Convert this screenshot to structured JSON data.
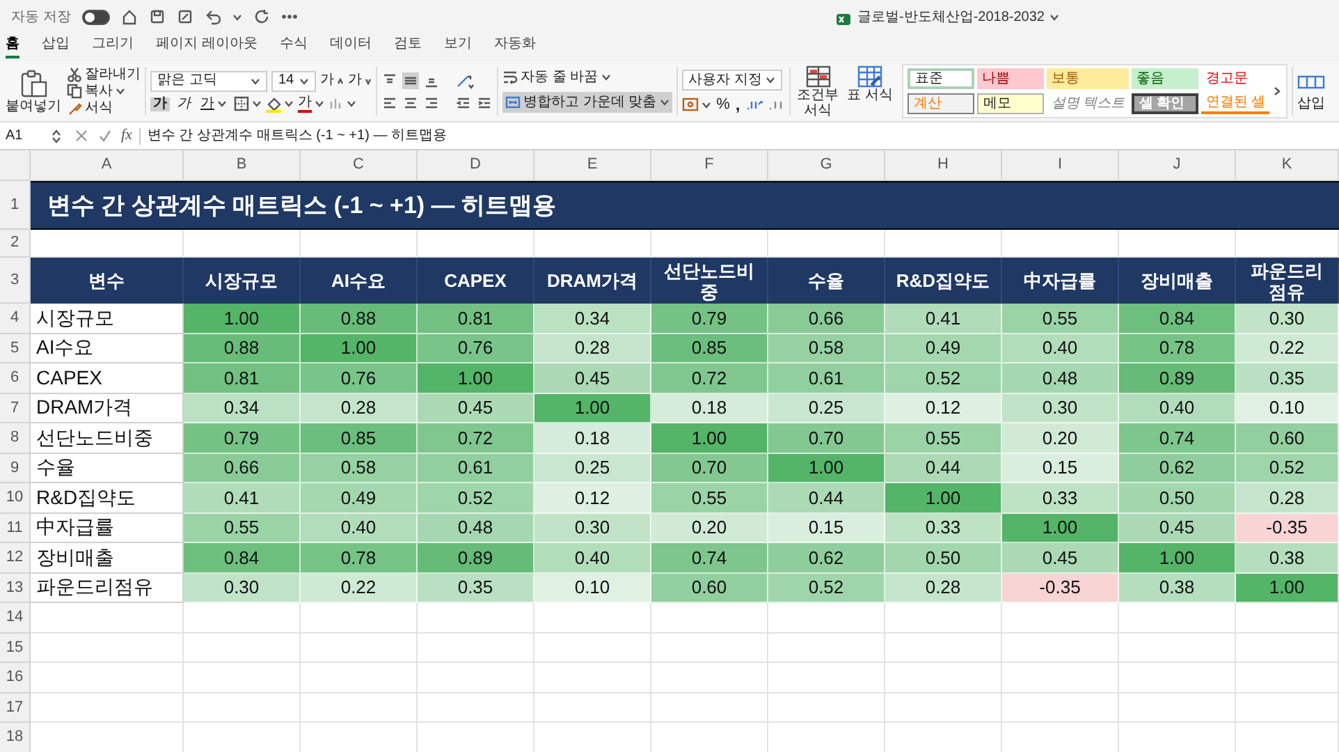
{
  "quick_access": {
    "autosave_label": "자동 저장",
    "autosave_on": false
  },
  "document_title": "글로벌-반도체산업-2018-2032",
  "tabs": [
    {
      "label": "홈",
      "selected": true
    },
    {
      "label": "삽입",
      "selected": false
    },
    {
      "label": "그리기",
      "selected": false
    },
    {
      "label": "페이지 레이아웃",
      "selected": false
    },
    {
      "label": "수식",
      "selected": false
    },
    {
      "label": "데이터",
      "selected": false
    },
    {
      "label": "검토",
      "selected": false
    },
    {
      "label": "보기",
      "selected": false
    },
    {
      "label": "자동화",
      "selected": false
    }
  ],
  "ribbon": {
    "clipboard": {
      "paste": "붙여넣기",
      "cut": "잘라내기",
      "copy": "복사",
      "format_painter": "서식"
    },
    "font": {
      "name": "맑은 고딕",
      "size": "14",
      "grow_glyph": "가",
      "shrink_glyph": "가",
      "bold_glyph": "가",
      "italic_glyph": "가",
      "underline_glyph": "가",
      "color_glyph": "가",
      "bold_on": true
    },
    "wrap_text": "자동 줄 바꿈",
    "merge_center": {
      "label": "병합하고 가운데 맞춤",
      "on": true
    },
    "number_format": "사용자 지정",
    "percent": "%",
    "comma": ",",
    "conditional_formatting": "조건부 서식",
    "format_as_table": "표 서식",
    "cell_styles": [
      {
        "label": "표준",
        "kind": "normal"
      },
      {
        "label": "나쁨",
        "kind": "bad"
      },
      {
        "label": "보통",
        "kind": "neutral"
      },
      {
        "label": "좋음",
        "kind": "good"
      },
      {
        "label": "경고문",
        "kind": "warning"
      },
      {
        "label": "계산",
        "kind": "calculation"
      },
      {
        "label": "메모",
        "kind": "note"
      },
      {
        "label": "설명 텍스트",
        "kind": "explanatory"
      },
      {
        "label": "셀 확인",
        "kind": "check"
      },
      {
        "label": "연결된 셀",
        "kind": "linked"
      }
    ],
    "insert": "삽입"
  },
  "formula_bar": {
    "name_box": "A1",
    "function_label": "fx",
    "formula": "변수 간 상관계수 매트릭스 (-1 ~ +1) — 히트맵용"
  },
  "sheet": {
    "columns": [
      "A",
      "B",
      "C",
      "D",
      "E",
      "F",
      "G",
      "H",
      "I",
      "J",
      "K"
    ],
    "rows": [
      "1",
      "2",
      "3",
      "4",
      "5",
      "6",
      "7",
      "8",
      "9",
      "10",
      "11",
      "12",
      "13",
      "14",
      "15",
      "16",
      "17",
      "18"
    ],
    "title": "변수 간 상관계수 매트릭스 (-1 ~ +1) — 히트맵용",
    "header": [
      "변수",
      "시장규모",
      "AI수요",
      "CAPEX",
      "DRAM가격",
      "선단노드비중",
      "수율",
      "R&D집약도",
      "中자급률",
      "장비매출",
      "파운드리점유"
    ],
    "matrix": [
      {
        "label": "시장규모",
        "values": [
          "1.00",
          "0.88",
          "0.81",
          "0.34",
          "0.79",
          "0.66",
          "0.41",
          "0.55",
          "0.84",
          "0.30"
        ]
      },
      {
        "label": "AI수요",
        "values": [
          "0.88",
          "1.00",
          "0.76",
          "0.28",
          "0.85",
          "0.58",
          "0.49",
          "0.40",
          "0.78",
          "0.22"
        ]
      },
      {
        "label": "CAPEX",
        "values": [
          "0.81",
          "0.76",
          "1.00",
          "0.45",
          "0.72",
          "0.61",
          "0.52",
          "0.48",
          "0.89",
          "0.35"
        ]
      },
      {
        "label": "DRAM가격",
        "values": [
          "0.34",
          "0.28",
          "0.45",
          "1.00",
          "0.18",
          "0.25",
          "0.12",
          "0.30",
          "0.40",
          "0.10"
        ]
      },
      {
        "label": "선단노드비중",
        "values": [
          "0.79",
          "0.85",
          "0.72",
          "0.18",
          "1.00",
          "0.70",
          "0.55",
          "0.20",
          "0.74",
          "0.60"
        ]
      },
      {
        "label": "수율",
        "values": [
          "0.66",
          "0.58",
          "0.61",
          "0.25",
          "0.70",
          "1.00",
          "0.44",
          "0.15",
          "0.62",
          "0.52"
        ]
      },
      {
        "label": "R&D집약도",
        "values": [
          "0.41",
          "0.49",
          "0.52",
          "0.12",
          "0.55",
          "0.44",
          "1.00",
          "0.33",
          "0.50",
          "0.28"
        ]
      },
      {
        "label": "中자급률",
        "values": [
          "0.55",
          "0.40",
          "0.48",
          "0.30",
          "0.20",
          "0.15",
          "0.33",
          "1.00",
          "0.45",
          "-0.35"
        ]
      },
      {
        "label": "장비매출",
        "values": [
          "0.84",
          "0.78",
          "0.89",
          "0.40",
          "0.74",
          "0.62",
          "0.50",
          "0.45",
          "1.00",
          "0.38"
        ]
      },
      {
        "label": "파운드리점유",
        "values": [
          "0.30",
          "0.22",
          "0.35",
          "0.10",
          "0.60",
          "0.52",
          "0.28",
          "-0.35",
          "0.38",
          "1.00"
        ]
      }
    ]
  }
}
